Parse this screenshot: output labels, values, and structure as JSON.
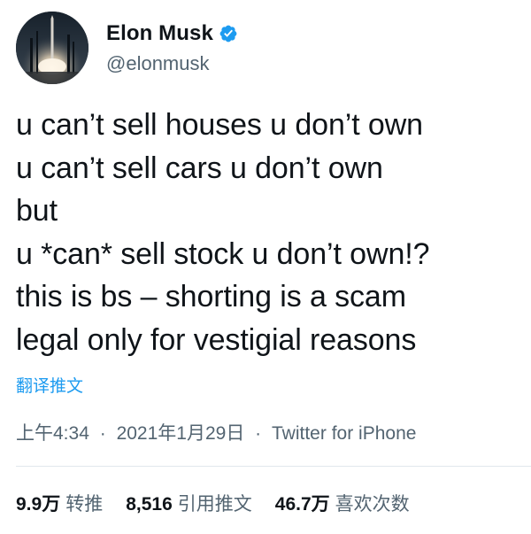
{
  "author": {
    "name": "Elon Musk",
    "handle": "@elonmusk",
    "verified": true,
    "verified_icon": "verified-badge-icon",
    "verified_color": "#1d9bf0"
  },
  "tweet": {
    "lines": [
      "u can’t sell houses u don’t own",
      "u can’t sell cars u don’t own",
      "but",
      "u *can* sell stock u don’t own!?",
      "this is bs – shorting is a scam",
      "legal only for vestigial reasons"
    ],
    "translate_label": "翻译推文"
  },
  "meta": {
    "time": "上午4:34",
    "date": "2021年1月29日",
    "source": "Twitter for iPhone",
    "separator": "·"
  },
  "stats": {
    "retweets": {
      "count": "9.9万",
      "label": "转推"
    },
    "quotes": {
      "count": "8,516",
      "label": "引用推文"
    },
    "likes": {
      "count": "46.7万",
      "label": "喜欢次数"
    }
  },
  "colors": {
    "text": "#0f1419",
    "secondary": "#536471",
    "link": "#1d9bf0",
    "divider": "#e1e8ed"
  }
}
